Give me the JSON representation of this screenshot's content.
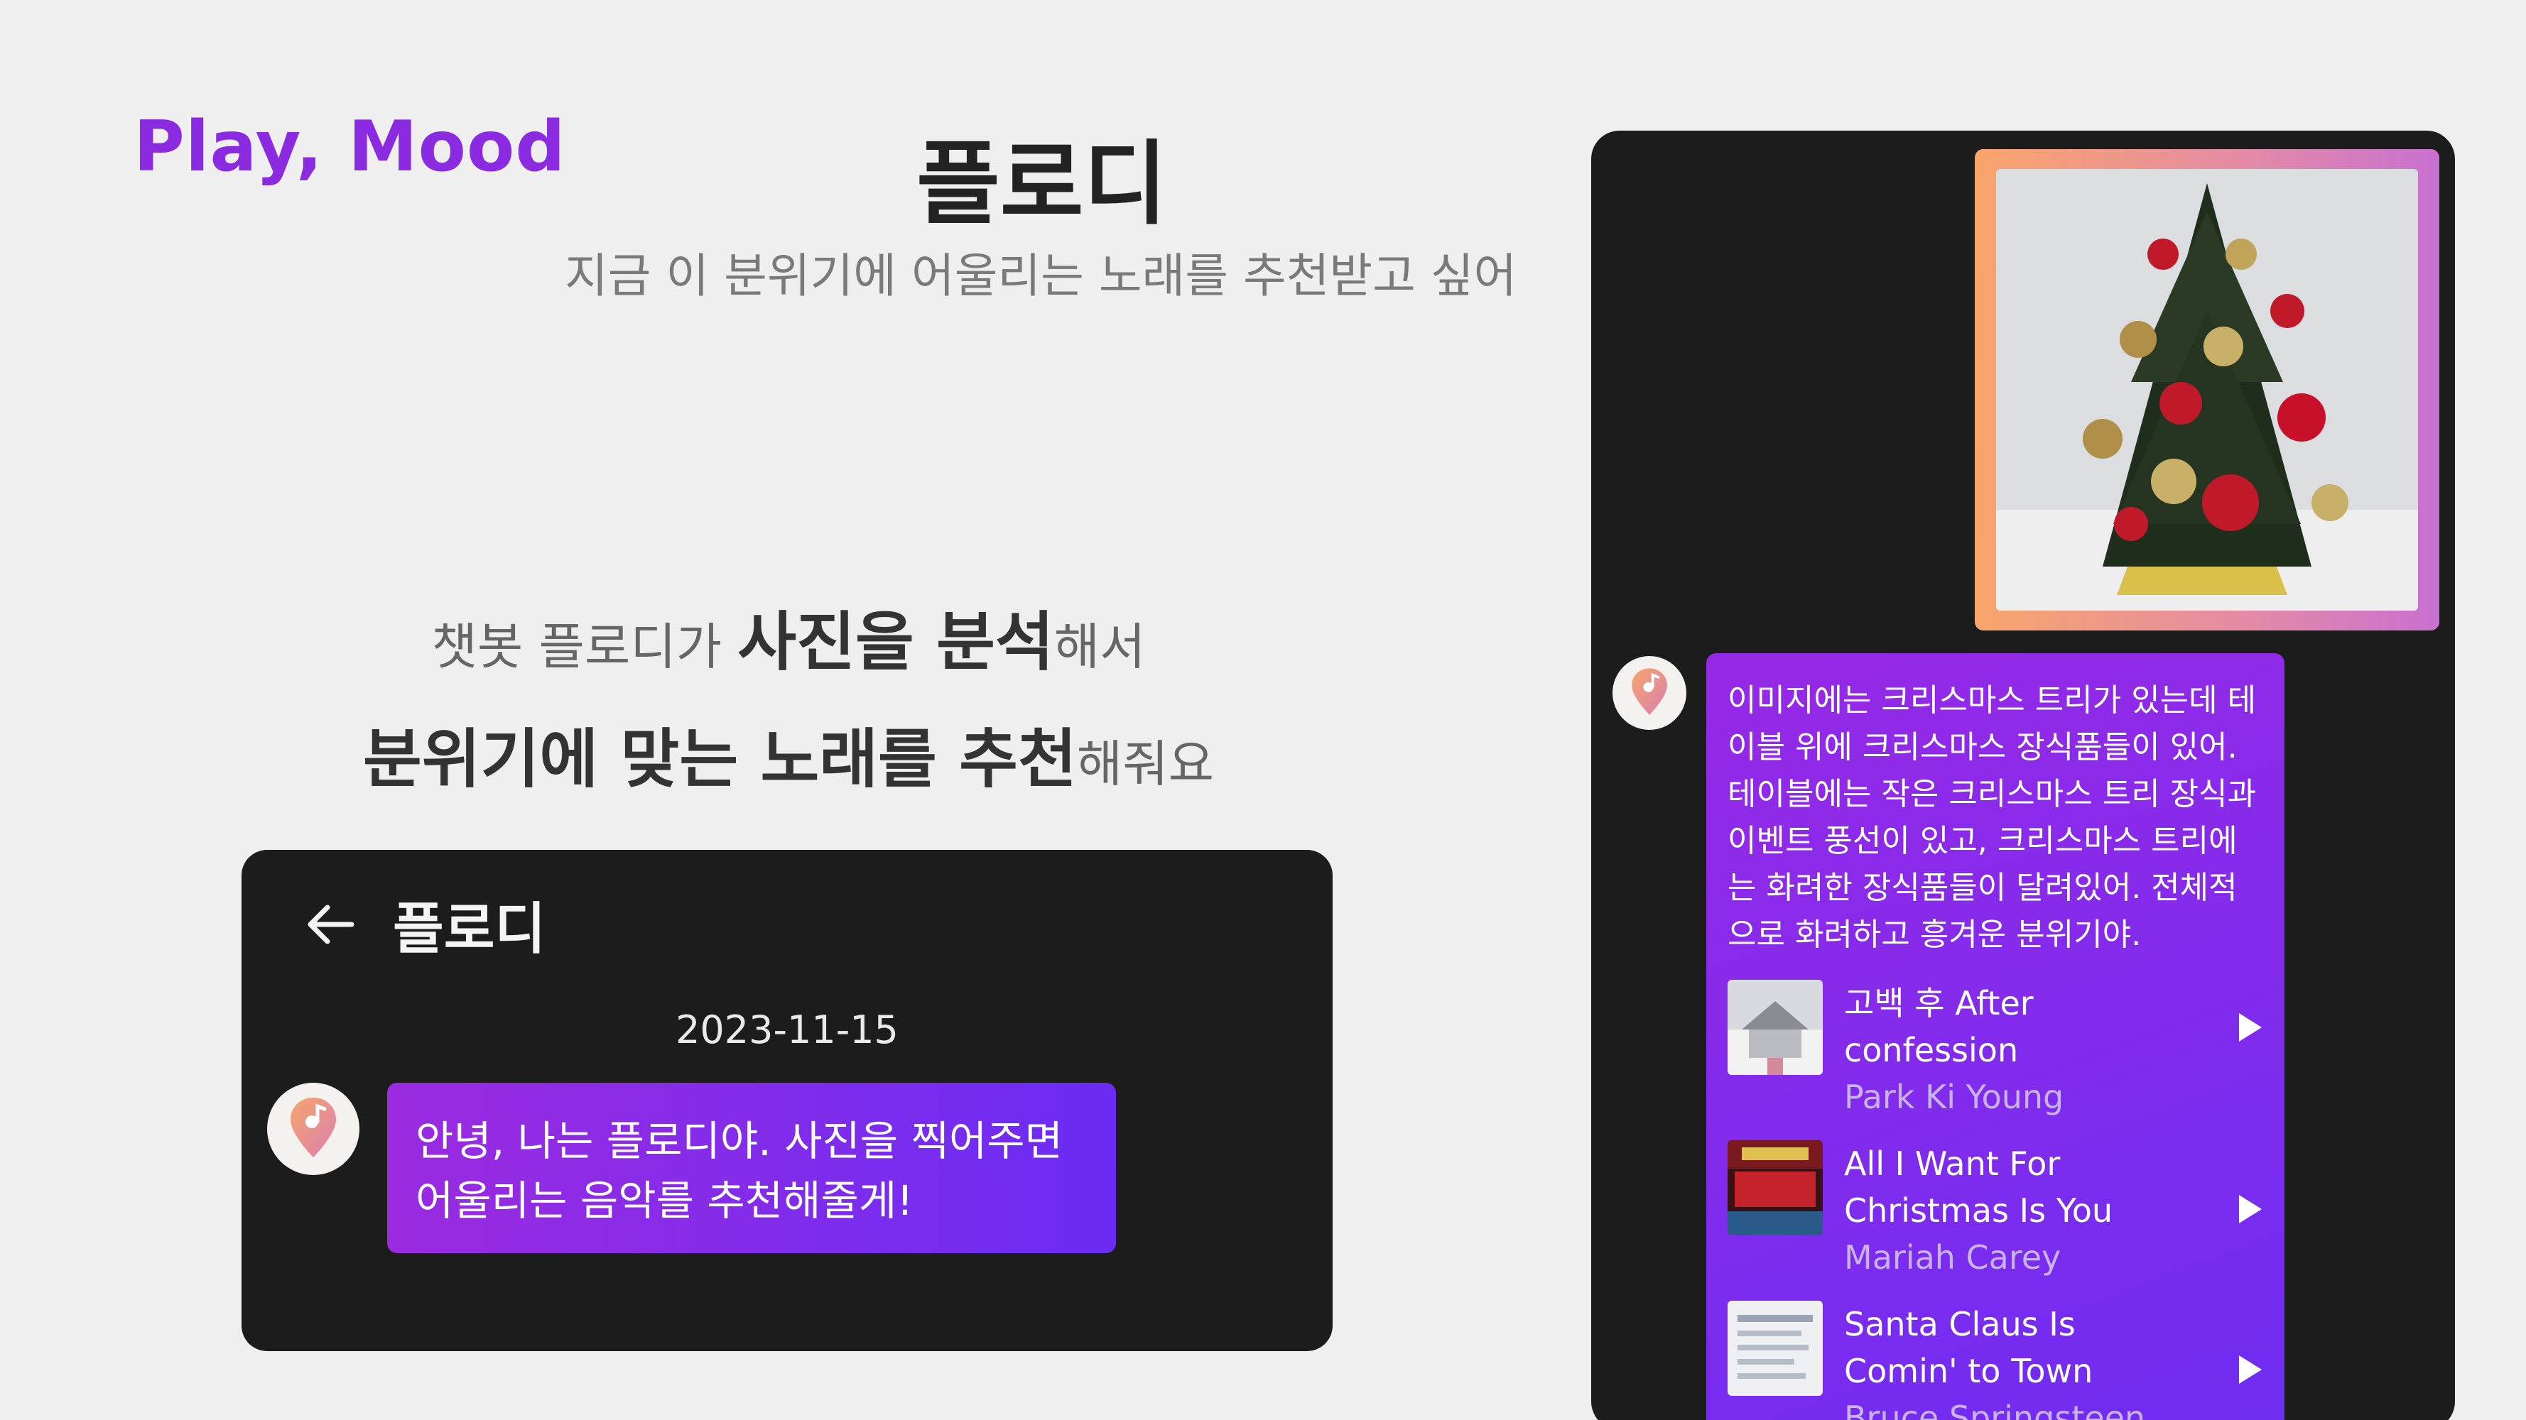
{
  "brand": "Play, Mood",
  "app_title": "플로디",
  "app_subtitle": "지금 이 분위기에 어울리는 노래를 추천받고 싶어",
  "feature": {
    "line1_a": "챗봇 플로디가 ",
    "line1_b": "사진을 분석",
    "line1_c": "해서",
    "line2_a": "분위기에 맞는 노래를 추천",
    "line2_b": "해줘요"
  },
  "chat": {
    "header_title": "플로디",
    "date": "2023-11-15",
    "greeting": "안녕, 나는 플로디야. 사진을 찍어주면 어울리는 음악를 추천해줄게!"
  },
  "reply": {
    "text": "이미지에는 크리스마스 트리가 있는데 테이블 위에 크리스마스 장식품들이 있어. 테이블에는 작은 크리스마스 트리 장식과 이벤트 풍선이 있고, 크리스마스 트리에는 화려한 장식품들이 달려있어. 전체적으로 화려하고 흥겨운 분위기야.",
    "tracks": [
      {
        "title": "고백 후 After confession",
        "artist": "Park Ki Young"
      },
      {
        "title": "All I Want For Christmas Is You",
        "artist": "Mariah Carey"
      },
      {
        "title": "Santa Claus Is Comin' to Town",
        "artist": "Bruce Springsteen"
      }
    ]
  },
  "colors": {
    "brand": "#8a2be2",
    "bubble_start": "#9b2be0",
    "bubble_end": "#6b2cf4",
    "panel": "#1c1c1c",
    "background": "#efefef"
  },
  "icons": {
    "back": "arrow-left-icon",
    "avatar": "location-pin-icon",
    "play": "play-triangle-icon"
  }
}
